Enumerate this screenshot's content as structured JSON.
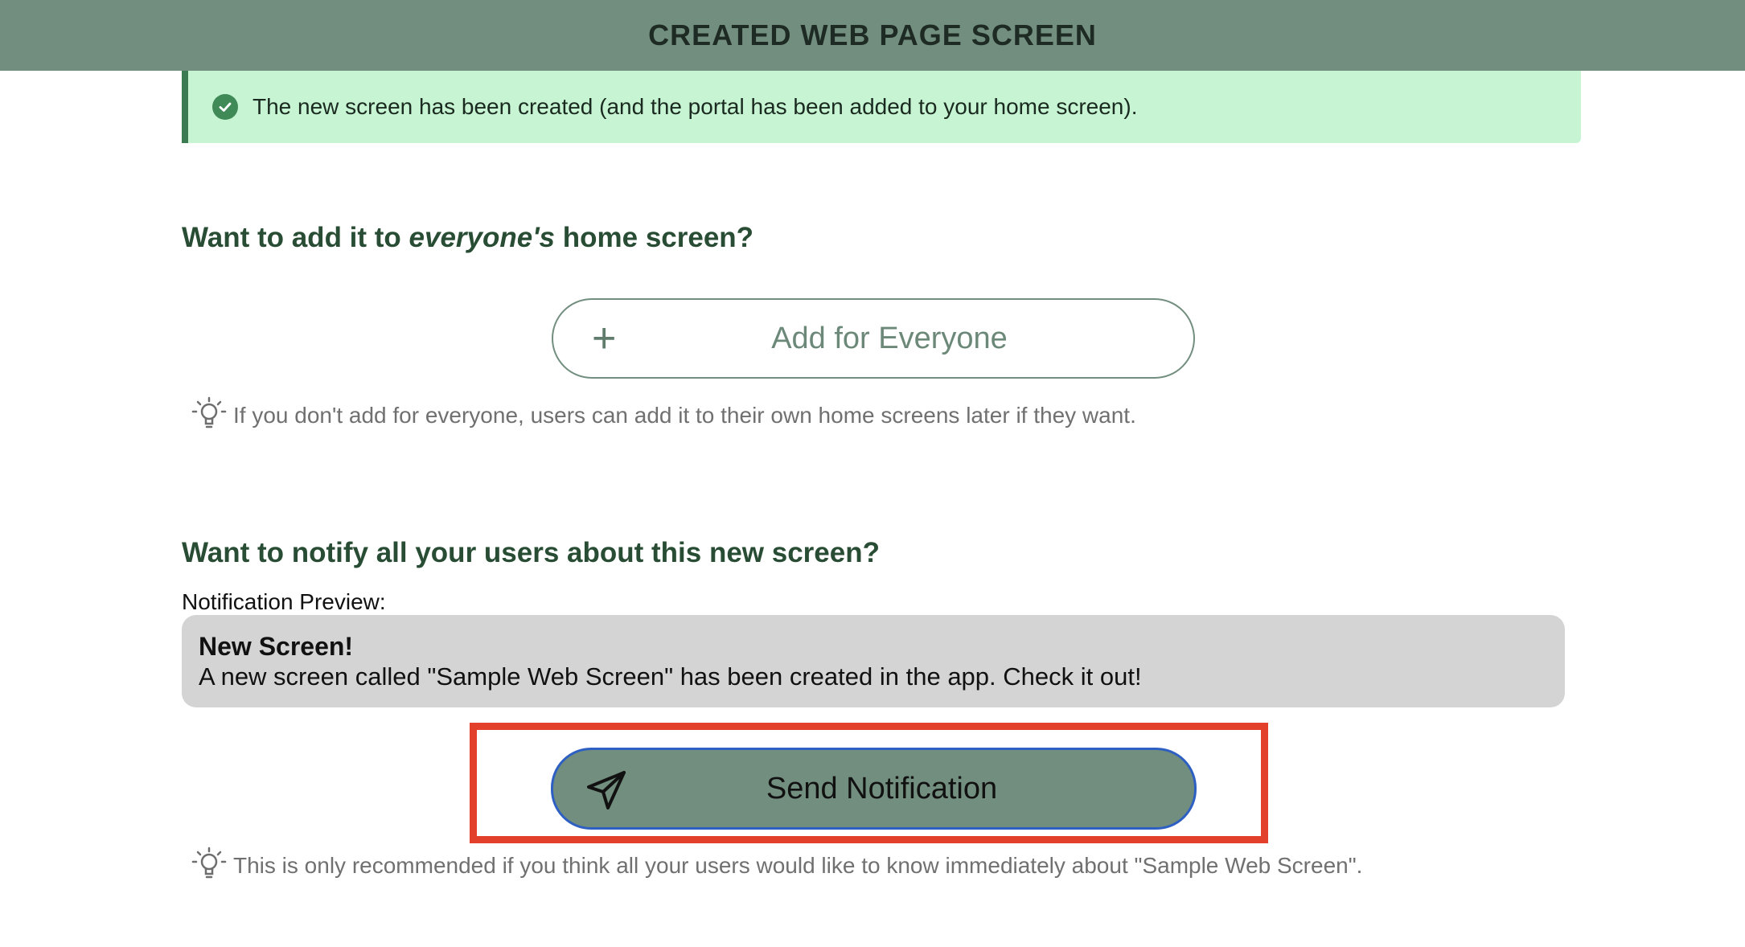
{
  "header": {
    "title": "CREATED WEB PAGE SCREEN"
  },
  "alert": {
    "message": "The new screen has been created (and the portal has been added to your home screen)."
  },
  "add_section": {
    "title_part1": "Want to add it to ",
    "title_emphasis": "everyone's",
    "title_part2": " home screen?",
    "button_label": "Add for Everyone",
    "hint": "If you don't add for everyone, users can add it to their own home screens later if they want."
  },
  "notify_section": {
    "title": "Want to notify all your users about this new screen?",
    "preview_label": "Notification Preview:",
    "preview_title": "New Screen!",
    "preview_body": "A new screen called \"Sample Web Screen\" has been created in the app. Check it out!",
    "button_label": "Send Notification",
    "hint": "This is only recommended if you think all your users would like to know immediately about \"Sample Web Screen\"."
  },
  "colors": {
    "header_bg": "#728e7f",
    "alert_bg": "#c7f4d2",
    "heading": "#284d34",
    "highlight": "#e3402c"
  },
  "icons": [
    "check-circle-icon",
    "plus-icon",
    "lightbulb-icon",
    "paper-plane-icon"
  ]
}
